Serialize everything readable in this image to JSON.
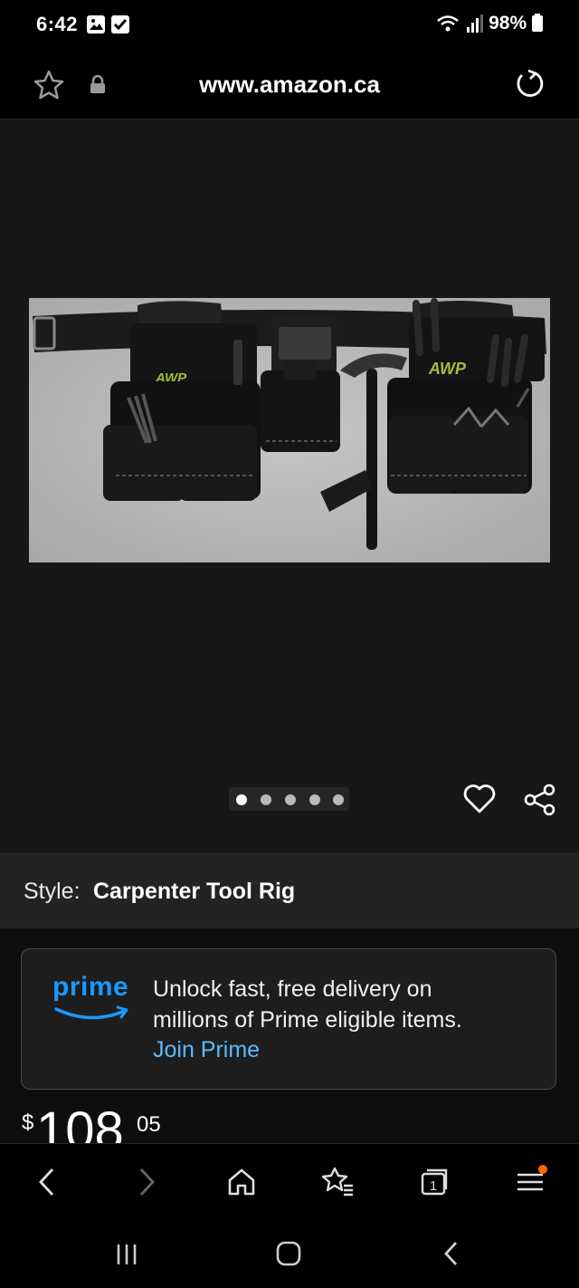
{
  "status_bar": {
    "time": "6:42",
    "battery": "98%"
  },
  "browser": {
    "url": "www.amazon.ca"
  },
  "gallery": {
    "image_count": 5,
    "active_index": 0,
    "brand_mark": "AWP"
  },
  "style": {
    "label": "Style:",
    "value": "Carpenter Tool Rig"
  },
  "prime": {
    "logo_text": "prime",
    "line1": "Unlock fast, free delivery on",
    "line2": "millions of Prime eligible items.",
    "link": "Join Prime"
  },
  "price": {
    "currency": "$",
    "whole": "108",
    "fraction": "05"
  },
  "bottom_nav": {
    "tabs_count": "1"
  },
  "colors": {
    "prime_blue": "#1a98ff",
    "link_blue": "#5dbaff",
    "notification_dot": "#ff6a00"
  }
}
